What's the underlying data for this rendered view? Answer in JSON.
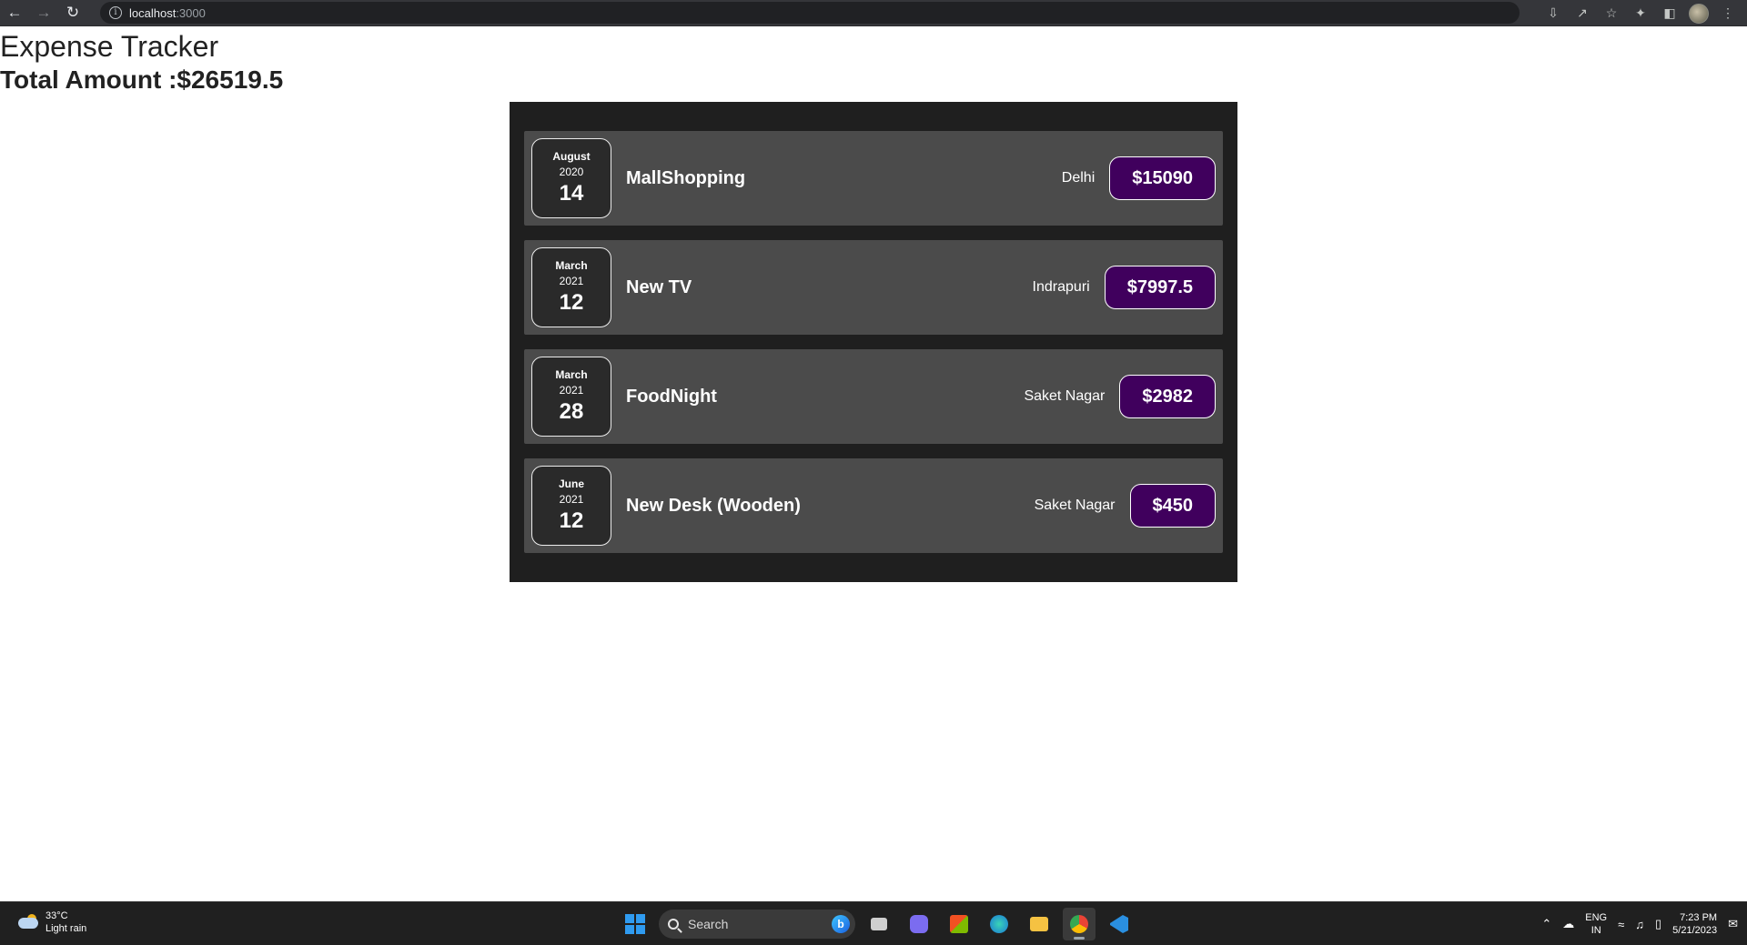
{
  "browser": {
    "url_host": "localhost",
    "url_port": ":3000",
    "back_icon": "arrow-left-icon",
    "forward_icon": "arrow-right-icon",
    "reload_icon": "reload-icon"
  },
  "app": {
    "title": "Expense Tracker",
    "total_label": "Total Amount :$26519.5"
  },
  "expenses": [
    {
      "month": "August",
      "year": "2020",
      "day": "14",
      "title": "MallShopping",
      "location": "Delhi",
      "amount": "$15090"
    },
    {
      "month": "March",
      "year": "2021",
      "day": "12",
      "title": "New TV",
      "location": "Indrapuri",
      "amount": "$7997.5"
    },
    {
      "month": "March",
      "year": "2021",
      "day": "28",
      "title": "FoodNight",
      "location": "Saket Nagar",
      "amount": "$2982"
    },
    {
      "month": "June",
      "year": "2021",
      "day": "12",
      "title": "New Desk (Wooden)",
      "location": "Saket Nagar",
      "amount": "$450"
    }
  ],
  "taskbar": {
    "weather_temp": "33°C",
    "weather_desc": "Light rain",
    "search_placeholder": "Search",
    "lang_top": "ENG",
    "lang_bottom": "IN",
    "time": "7:23 PM",
    "date": "5/21/2023"
  },
  "colors": {
    "card_bg": "#1f1f1f",
    "item_bg": "#4b4b4b",
    "price_bg": "#40005d"
  }
}
